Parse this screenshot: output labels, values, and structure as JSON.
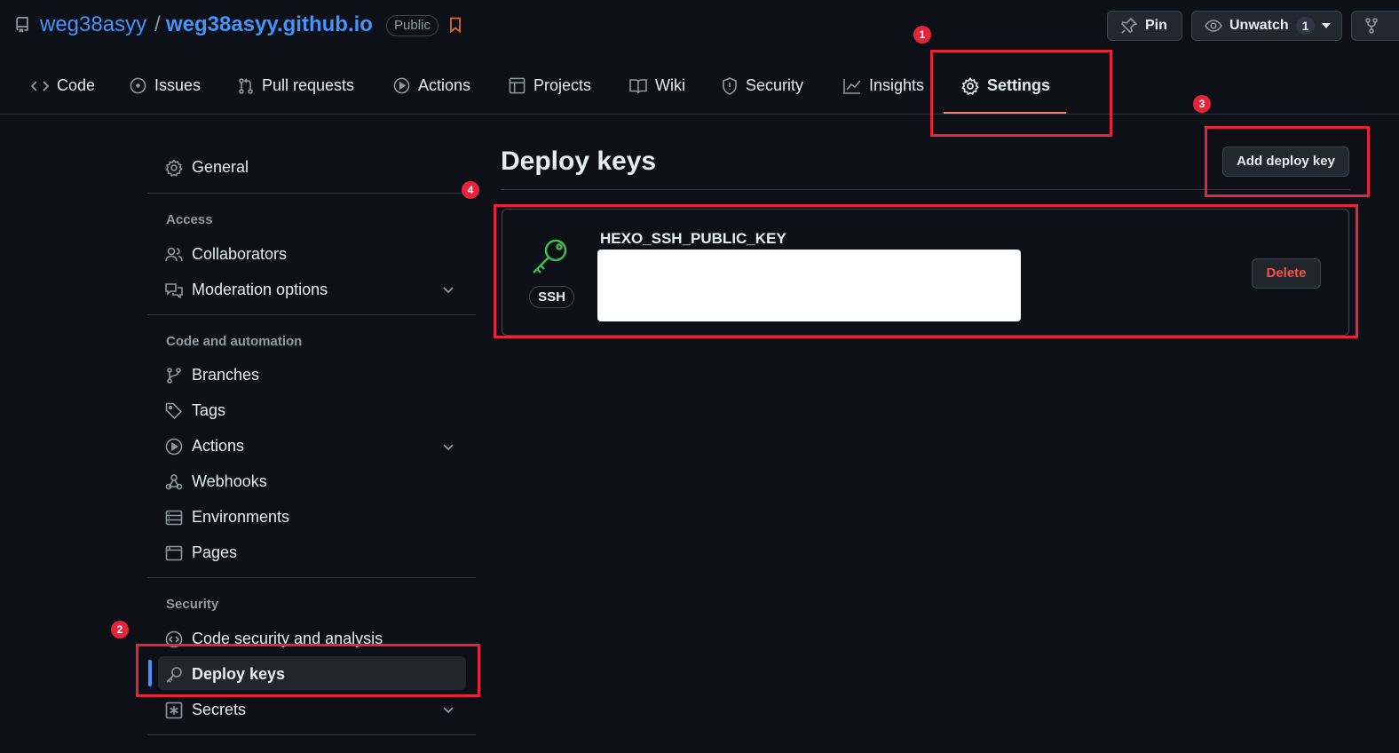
{
  "repo": {
    "owner": "weg38asyy",
    "separator": "/",
    "name": "weg38asyy.github.io",
    "visibility": "Public"
  },
  "header_actions": {
    "pin_label": "Pin",
    "watch_label": "Unwatch",
    "watch_count": "1"
  },
  "tabs": [
    {
      "label": "Code",
      "icon": "code-icon"
    },
    {
      "label": "Issues",
      "icon": "issue-icon"
    },
    {
      "label": "Pull requests",
      "icon": "pull-request-icon"
    },
    {
      "label": "Actions",
      "icon": "play-icon"
    },
    {
      "label": "Projects",
      "icon": "table-icon"
    },
    {
      "label": "Wiki",
      "icon": "book-icon"
    },
    {
      "label": "Security",
      "icon": "shield-icon"
    },
    {
      "label": "Insights",
      "icon": "graph-icon"
    },
    {
      "label": "Settings",
      "icon": "gear-icon",
      "selected": true
    }
  ],
  "sidebar": {
    "general": "General",
    "groups": [
      {
        "heading": "Access",
        "items": [
          "Collaborators",
          "Moderation options"
        ]
      },
      {
        "heading": "Code and automation",
        "items": [
          "Branches",
          "Tags",
          "Actions",
          "Webhooks",
          "Environments",
          "Pages"
        ]
      },
      {
        "heading": "Security",
        "items": [
          "Code security and analysis",
          "Deploy keys",
          "Secrets"
        ]
      }
    ],
    "active_item": "Deploy keys"
  },
  "main": {
    "title": "Deploy keys",
    "add_button": "Add deploy key",
    "keys": [
      {
        "name": "HEXO_SSH_PUBLIC_KEY",
        "type": "SSH",
        "delete_label": "Delete"
      }
    ]
  },
  "annotations": [
    "1",
    "2",
    "3",
    "4"
  ],
  "colors": {
    "background": "#0d1117",
    "link": "#4493f8",
    "tab_underline": "#f78166",
    "danger": "#f85149",
    "annotation": "#e5243b",
    "key_icon": "#3fb950"
  }
}
